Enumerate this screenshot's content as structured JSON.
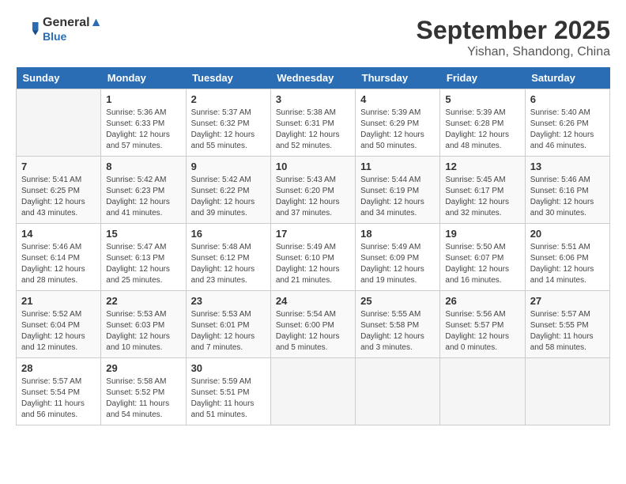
{
  "header": {
    "logo_line1": "General",
    "logo_line2": "Blue",
    "main_title": "September 2025",
    "sub_title": "Yishan, Shandong, China"
  },
  "days_of_week": [
    "Sunday",
    "Monday",
    "Tuesday",
    "Wednesday",
    "Thursday",
    "Friday",
    "Saturday"
  ],
  "weeks": [
    [
      {
        "day": "",
        "info": ""
      },
      {
        "day": "1",
        "info": "Sunrise: 5:36 AM\nSunset: 6:33 PM\nDaylight: 12 hours\nand 57 minutes."
      },
      {
        "day": "2",
        "info": "Sunrise: 5:37 AM\nSunset: 6:32 PM\nDaylight: 12 hours\nand 55 minutes."
      },
      {
        "day": "3",
        "info": "Sunrise: 5:38 AM\nSunset: 6:31 PM\nDaylight: 12 hours\nand 52 minutes."
      },
      {
        "day": "4",
        "info": "Sunrise: 5:39 AM\nSunset: 6:29 PM\nDaylight: 12 hours\nand 50 minutes."
      },
      {
        "day": "5",
        "info": "Sunrise: 5:39 AM\nSunset: 6:28 PM\nDaylight: 12 hours\nand 48 minutes."
      },
      {
        "day": "6",
        "info": "Sunrise: 5:40 AM\nSunset: 6:26 PM\nDaylight: 12 hours\nand 46 minutes."
      }
    ],
    [
      {
        "day": "7",
        "info": "Sunrise: 5:41 AM\nSunset: 6:25 PM\nDaylight: 12 hours\nand 43 minutes."
      },
      {
        "day": "8",
        "info": "Sunrise: 5:42 AM\nSunset: 6:23 PM\nDaylight: 12 hours\nand 41 minutes."
      },
      {
        "day": "9",
        "info": "Sunrise: 5:42 AM\nSunset: 6:22 PM\nDaylight: 12 hours\nand 39 minutes."
      },
      {
        "day": "10",
        "info": "Sunrise: 5:43 AM\nSunset: 6:20 PM\nDaylight: 12 hours\nand 37 minutes."
      },
      {
        "day": "11",
        "info": "Sunrise: 5:44 AM\nSunset: 6:19 PM\nDaylight: 12 hours\nand 34 minutes."
      },
      {
        "day": "12",
        "info": "Sunrise: 5:45 AM\nSunset: 6:17 PM\nDaylight: 12 hours\nand 32 minutes."
      },
      {
        "day": "13",
        "info": "Sunrise: 5:46 AM\nSunset: 6:16 PM\nDaylight: 12 hours\nand 30 minutes."
      }
    ],
    [
      {
        "day": "14",
        "info": "Sunrise: 5:46 AM\nSunset: 6:14 PM\nDaylight: 12 hours\nand 28 minutes."
      },
      {
        "day": "15",
        "info": "Sunrise: 5:47 AM\nSunset: 6:13 PM\nDaylight: 12 hours\nand 25 minutes."
      },
      {
        "day": "16",
        "info": "Sunrise: 5:48 AM\nSunset: 6:12 PM\nDaylight: 12 hours\nand 23 minutes."
      },
      {
        "day": "17",
        "info": "Sunrise: 5:49 AM\nSunset: 6:10 PM\nDaylight: 12 hours\nand 21 minutes."
      },
      {
        "day": "18",
        "info": "Sunrise: 5:49 AM\nSunset: 6:09 PM\nDaylight: 12 hours\nand 19 minutes."
      },
      {
        "day": "19",
        "info": "Sunrise: 5:50 AM\nSunset: 6:07 PM\nDaylight: 12 hours\nand 16 minutes."
      },
      {
        "day": "20",
        "info": "Sunrise: 5:51 AM\nSunset: 6:06 PM\nDaylight: 12 hours\nand 14 minutes."
      }
    ],
    [
      {
        "day": "21",
        "info": "Sunrise: 5:52 AM\nSunset: 6:04 PM\nDaylight: 12 hours\nand 12 minutes."
      },
      {
        "day": "22",
        "info": "Sunrise: 5:53 AM\nSunset: 6:03 PM\nDaylight: 12 hours\nand 10 minutes."
      },
      {
        "day": "23",
        "info": "Sunrise: 5:53 AM\nSunset: 6:01 PM\nDaylight: 12 hours\nand 7 minutes."
      },
      {
        "day": "24",
        "info": "Sunrise: 5:54 AM\nSunset: 6:00 PM\nDaylight: 12 hours\nand 5 minutes."
      },
      {
        "day": "25",
        "info": "Sunrise: 5:55 AM\nSunset: 5:58 PM\nDaylight: 12 hours\nand 3 minutes."
      },
      {
        "day": "26",
        "info": "Sunrise: 5:56 AM\nSunset: 5:57 PM\nDaylight: 12 hours\nand 0 minutes."
      },
      {
        "day": "27",
        "info": "Sunrise: 5:57 AM\nSunset: 5:55 PM\nDaylight: 11 hours\nand 58 minutes."
      }
    ],
    [
      {
        "day": "28",
        "info": "Sunrise: 5:57 AM\nSunset: 5:54 PM\nDaylight: 11 hours\nand 56 minutes."
      },
      {
        "day": "29",
        "info": "Sunrise: 5:58 AM\nSunset: 5:52 PM\nDaylight: 11 hours\nand 54 minutes."
      },
      {
        "day": "30",
        "info": "Sunrise: 5:59 AM\nSunset: 5:51 PM\nDaylight: 11 hours\nand 51 minutes."
      },
      {
        "day": "",
        "info": ""
      },
      {
        "day": "",
        "info": ""
      },
      {
        "day": "",
        "info": ""
      },
      {
        "day": "",
        "info": ""
      }
    ]
  ]
}
